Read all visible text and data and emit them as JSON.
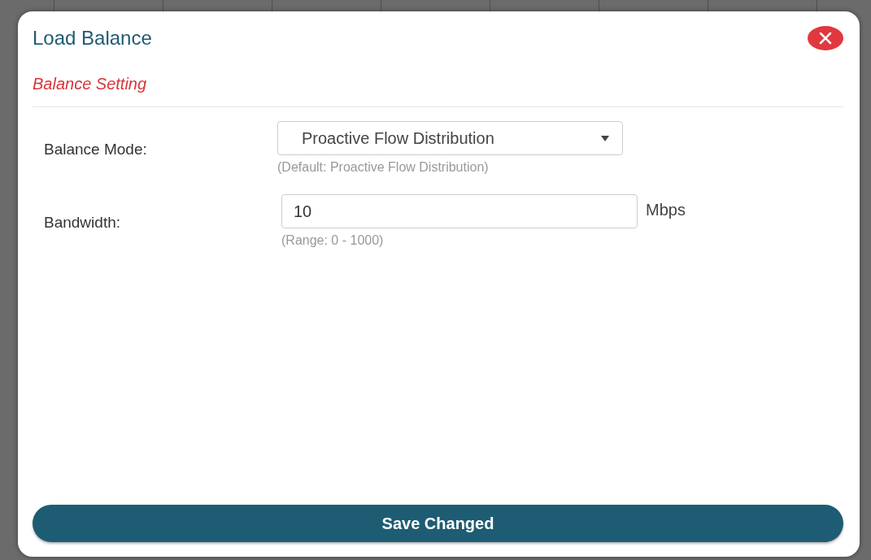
{
  "dialog": {
    "title": "Load Balance",
    "section": "Balance Setting"
  },
  "fields": [
    {
      "kind": "select",
      "label": "Balance Mode:",
      "value": "Proactive Flow Distribution",
      "hint": "(Default: Proactive Flow Distribution)"
    },
    {
      "kind": "input",
      "label": "Bandwidth:",
      "value": "10",
      "unit": "Mbps",
      "hint": "(Range: 0 - 1000)"
    }
  ],
  "button": "Save Changed"
}
